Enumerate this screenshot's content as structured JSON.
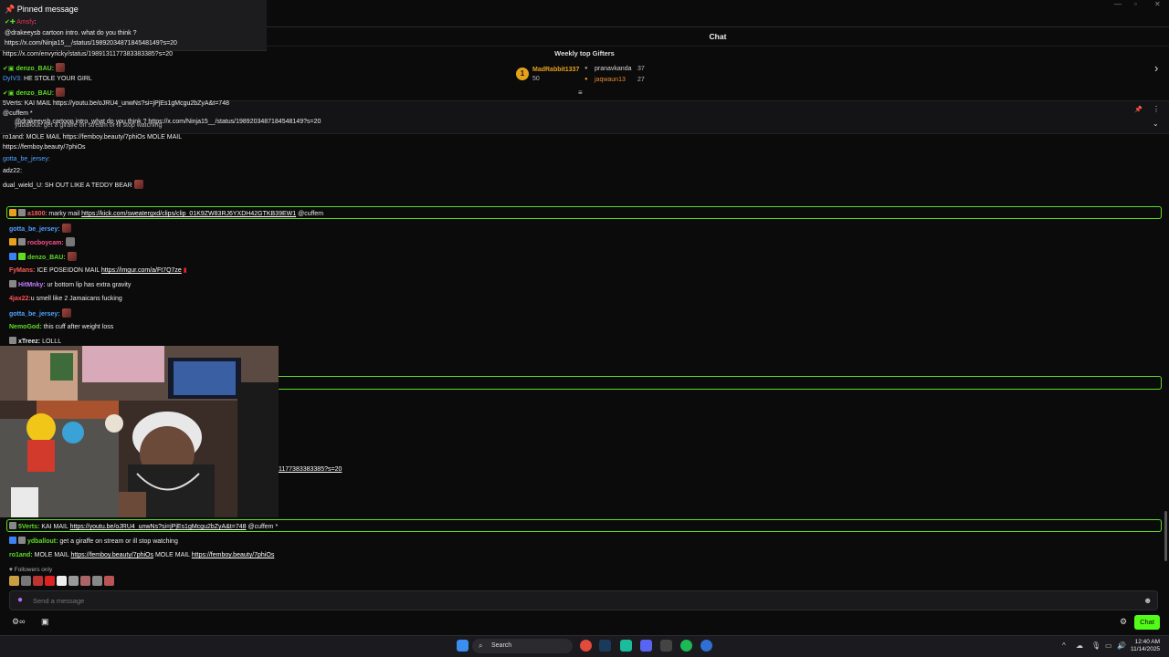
{
  "chat": {
    "title": "Chat",
    "weekly_title": "Weekly top Gifters",
    "gifters": [
      {
        "rank": "1",
        "name": "MadRabbit1337",
        "count": "50",
        "color": "#e7a21b"
      },
      {
        "name": "pranavkanda",
        "count": "37",
        "color": "#d7d7d7"
      },
      {
        "name": "jaqwaun13",
        "count": "27",
        "color": "#e98a2a"
      }
    ]
  },
  "pinned": {
    "heading": "Pinned message",
    "user": "Amsfy",
    "text": "@drakeeysb cartoon intro. what do you think ?",
    "link": "https://x.com/Ninja15__/status/1989203487184548149?s=20"
  },
  "overlay_lines": [
    {
      "text": "https://x.com/envyricky/status/1989131177383383385?s=20",
      "color": "#ffffff"
    },
    {
      "text": "denzo_BAU:",
      "color": "#5fdc23"
    },
    {
      "text": "DyIV3:",
      "color": "#4fa3ff",
      "extra": "HE STOLE YOUR GIRL"
    },
    {
      "text": "denzo_BAU:",
      "color": "#5fdc23"
    },
    {
      "text": "5Verts: KAI MAIL https://youtu.be/oJRU4_unwNs?si=jPjEs1gMcgu2bZyA&t=748",
      "color": "#ffffff"
    },
    {
      "text": "@cuffem *",
      "color": "#ffffff"
    },
    {
      "text": "@drakeeysb cartoon intro. what do you think ? https://x.com/Ninja15__/status/1989203487184548149?s=20",
      "color": "#ffffff"
    },
    {
      "text": "ydballout: get a giraffe on stream or ill stop watching",
      "color": "#ffffff"
    },
    {
      "text": "ro1and: MOLE MAIL https://femboy.beauty/7phiOs MOLE MAIL",
      "color": "#ffffff"
    },
    {
      "text": "https://femboy.beauty/7phiOs",
      "color": "#ffffff"
    },
    {
      "text": "gotta_be_jersey:",
      "color": "#4fa3ff"
    },
    {
      "text": "adz22:",
      "color": "#ffffff"
    },
    {
      "text": "dual_wield_U: SH OUT LIKE A TEDDY BEAR",
      "color": "#ffffff"
    }
  ],
  "messages": [
    {
      "user": "a1800",
      "color": "#ff5a5a",
      "text": "marky mail",
      "link": "https://kick.com/sweatergxd/clips/clip_01K9ZW83RJ6YXDH42GTKB39EW1",
      "suffix": "@cuffem",
      "highlight": true
    },
    {
      "user": "gotta_be_jersey:",
      "color": "#4fa3ff"
    },
    {
      "user": "rocboycam:",
      "color": "#ff4f8b"
    },
    {
      "user": "denzo_BAU:",
      "color": "#5fdc23"
    },
    {
      "user": "FyMans:",
      "color": "#ff5a5a",
      "text": "ICE POSEIDON MAIL",
      "link": "https://imgur.com/a/Ft7Q7ze"
    },
    {
      "user": "HitMnky:",
      "color": "#c77dff",
      "text": "ur bottom lip has extra gravity"
    },
    {
      "user": "4jax22:",
      "color": "#ff4f4f",
      "text": "u smell like 2 Jamaicans fucking"
    },
    {
      "user": "gotta_be_jersey:",
      "color": "#4fa3ff"
    },
    {
      "user": "NemoGod:",
      "color": "#5fdc23",
      "text": "this cuff after weight loss"
    },
    {
      "user": "xTreez:",
      "color": "#ffffff",
      "text": "LOLLL"
    }
  ],
  "partial_link": "1177383383385?s=20",
  "recent": [
    {
      "user": "5Verts:",
      "color": "#5fdc23",
      "text": "KAI MAIL",
      "link": "https://youtu.be/oJRU4_unwNs?si=jPjEs1gMcgu2bZyA&t=748",
      "suffix": "@cuffem *"
    },
    {
      "user": "ydballout:",
      "color": "#5fdc23",
      "text": "get a giraffe on stream or ill stop watching"
    },
    {
      "user": "ro1and:",
      "color": "#5fdc23",
      "text": "MOLE MAIL",
      "link": "https://femboy.beauty/7phiOs",
      "mid": "MOLE MAIL",
      "link2": "https://femboy.beauty/7phiOs"
    }
  ],
  "followers_only": "Followers only",
  "input": {
    "placeholder": "Send a message"
  },
  "chat_button": "Chat",
  "taskbar": {
    "search": "Search",
    "time": "12:40 AM",
    "date": "11/14/2025"
  }
}
